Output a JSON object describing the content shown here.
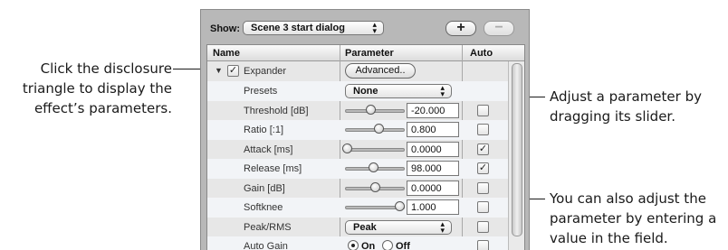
{
  "callouts": {
    "left": [
      "Click the disclosure",
      "triangle to display the",
      "effect’s parameters."
    ],
    "right_top": [
      "Adjust a parameter by",
      "dragging its slider."
    ],
    "right_bottom": [
      "You can also adjust the",
      "parameter by entering a",
      "value in the field."
    ]
  },
  "toolbar": {
    "show_label": "Show:",
    "show_value": "Scene 3 start dialog",
    "add_label": "+",
    "remove_label": "−"
  },
  "table": {
    "headers": {
      "name": "Name",
      "parameter": "Parameter",
      "auto": "Auto"
    },
    "effect": {
      "name": "Expander",
      "enabled": true,
      "advanced_label": "Advanced.."
    },
    "rows": [
      {
        "name": "Presets",
        "type": "popup",
        "value": "None"
      },
      {
        "name": "Threshold [dB]",
        "type": "slider",
        "value": "-20.000",
        "level": 0.43,
        "auto": false
      },
      {
        "name": "Ratio [:1]",
        "type": "slider",
        "value": "0.800",
        "level": 0.57,
        "auto": false
      },
      {
        "name": "Attack [ms]",
        "type": "slider",
        "value": "0.0000",
        "level": 0.0,
        "auto": true
      },
      {
        "name": "Release [ms]",
        "type": "slider",
        "value": "98.000",
        "level": 0.48,
        "auto": true
      },
      {
        "name": "Gain [dB]",
        "type": "slider",
        "value": "0.0000",
        "level": 0.51,
        "auto": false
      },
      {
        "name": "Softknee",
        "type": "slider",
        "value": "1.000",
        "level": 0.95,
        "auto": false
      },
      {
        "name": "Peak/RMS",
        "type": "popup",
        "value": "Peak",
        "auto": false
      },
      {
        "name": "Auto Gain",
        "type": "radio",
        "on_label": "On",
        "off_label": "Off",
        "selected": "On",
        "auto": false
      }
    ]
  }
}
